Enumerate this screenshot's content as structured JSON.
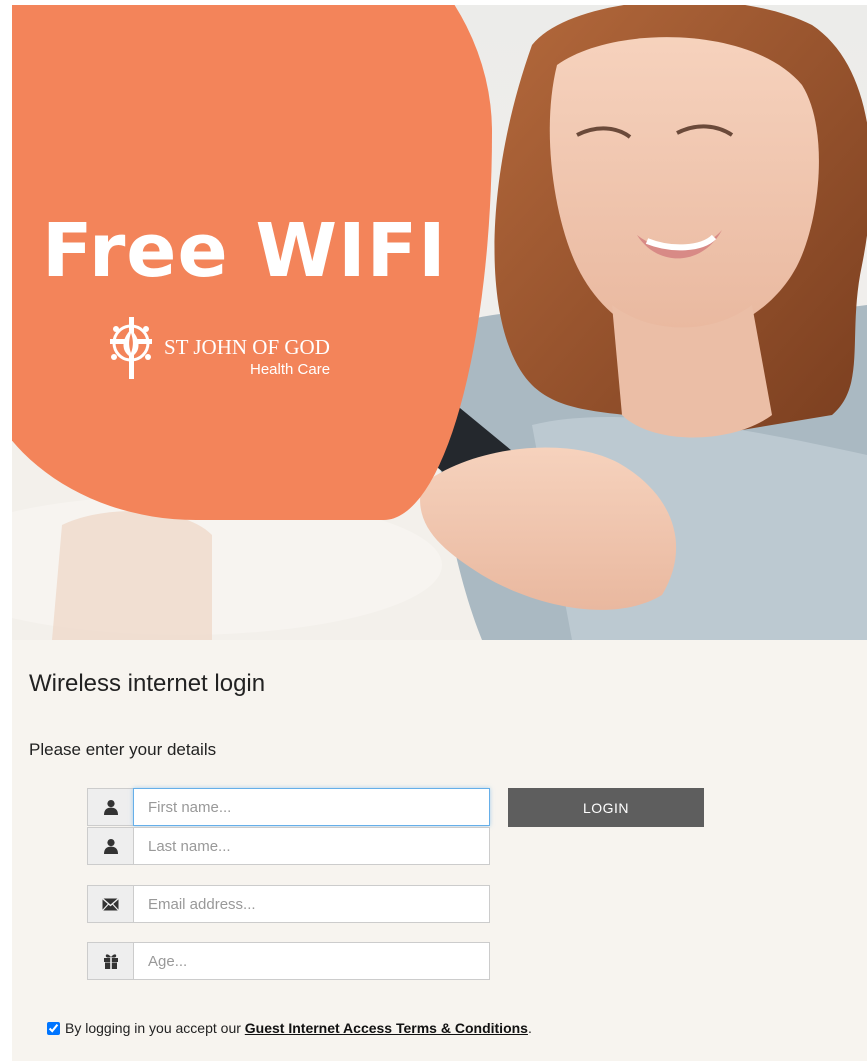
{
  "hero": {
    "headline": "Free WIFI",
    "brand_name": "ST JOHN OF GOD",
    "brand_sub": "Health Care",
    "accent_color": "#f3845a"
  },
  "page_title": "Wireless internet login",
  "subtitle": "Please enter your details",
  "form": {
    "first_name": {
      "placeholder": "First name...",
      "value": "",
      "icon": "user-icon"
    },
    "last_name": {
      "placeholder": "Last name...",
      "value": "",
      "icon": "user-icon"
    },
    "email": {
      "placeholder": "Email address...",
      "value": "",
      "icon": "envelope-icon"
    },
    "age": {
      "placeholder": "Age...",
      "value": "",
      "icon": "gift-icon"
    },
    "login_label": "LOGIN"
  },
  "terms": {
    "prefix": "By logging in you accept our",
    "link_text": "Guest Internet Access Terms & Conditions",
    "suffix": ".",
    "checked": true
  }
}
